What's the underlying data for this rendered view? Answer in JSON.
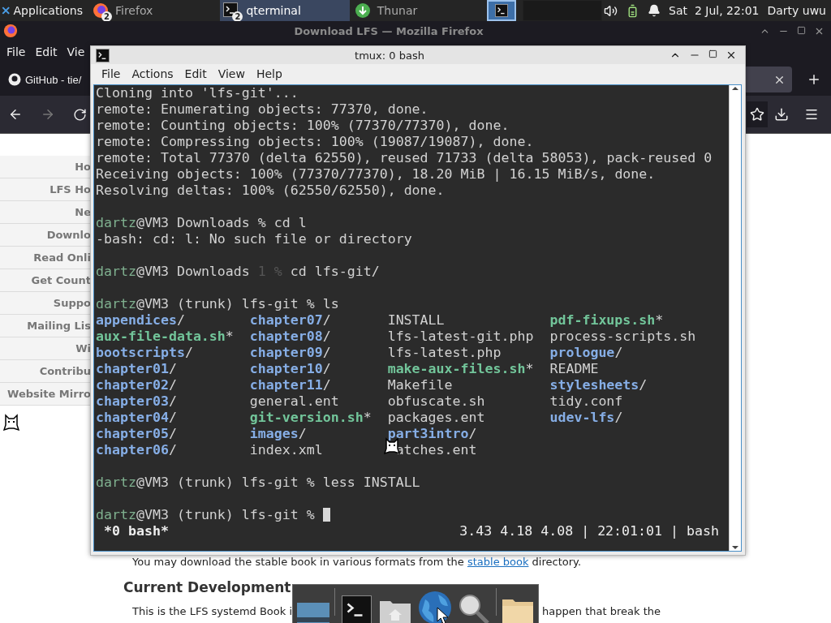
{
  "panel": {
    "apps_label": "Applications",
    "tasks": [
      {
        "kind": "firefox",
        "label": "Firefox",
        "badge": "2",
        "selected": false
      },
      {
        "kind": "terminal",
        "label": "qterminal",
        "badge": "2",
        "selected": true
      },
      {
        "kind": "files",
        "label": "Thunar",
        "selected": false
      }
    ],
    "workspaces": [
      {
        "selected": true
      },
      {
        "selected": false
      }
    ],
    "clock": "Sat  2 Jul, 22:01",
    "user": "Darty uwu"
  },
  "firefox": {
    "title": "Download LFS — Mozilla Firefox",
    "menu": [
      "File",
      "Edit",
      "Vie"
    ],
    "tabs": [
      {
        "label": "GitHub - tie/",
        "selected": false
      },
      {
        "selected": true
      }
    ],
    "sidebar": [
      "Ho",
      "LFS Ho",
      "Ne",
      "Downlo",
      "Read Onli",
      "Get Count",
      "Suppo",
      "Mailing Lis",
      "Wi",
      "Contribu",
      "Website Mirro"
    ],
    "page": {
      "intro": "You may download the stable book in various formats from the ",
      "link": "stable book",
      "intro_end": " directory.",
      "heading": "Current Development",
      "para_left": "This is the LFS systemd Book i",
      "para_right": "happen that break the"
    }
  },
  "terminal": {
    "title": "tmux: 0 bash",
    "menu": [
      "File",
      "Actions",
      "Edit",
      "View",
      "Help"
    ],
    "lines": [
      {
        "kind": "output",
        "text": "Cloning into 'lfs-git'..."
      },
      {
        "kind": "output",
        "text": "remote: Enumerating objects: 77370, done."
      },
      {
        "kind": "output",
        "text": "remote: Counting objects: 100% (77370/77370), done."
      },
      {
        "kind": "output",
        "text": "remote: Compressing objects: 100% (19087/19087), done."
      },
      {
        "kind": "output",
        "text": "remote: Total 77370 (delta 62550), reused 71733 (delta 58053), pack-reused 0"
      },
      {
        "kind": "output",
        "text": "Receiving objects: 100% (77370/77370), 18.20 MiB | 16.15 MiB/s, done."
      },
      {
        "kind": "output",
        "text": "Resolving deltas: 100% (62550/62550), done."
      },
      {
        "kind": "blank"
      },
      {
        "kind": "prompt",
        "parts": [
          {
            "text": "dartz",
            "kind": "user"
          },
          {
            "text": "@VM3 Downloads % cd l",
            "kind": "plain"
          }
        ]
      },
      {
        "kind": "output",
        "text": "-bash: cd: l: No such file or directory"
      },
      {
        "kind": "blank"
      },
      {
        "kind": "prompt",
        "parts": [
          {
            "text": "dartz",
            "kind": "user"
          },
          {
            "text": "@VM3 Downloads ",
            "kind": "plain"
          },
          {
            "text": "1 %",
            "kind": "dim"
          },
          {
            "text": " cd lfs-git/",
            "kind": "plain"
          }
        ]
      },
      {
        "kind": "blank"
      },
      {
        "kind": "prompt",
        "parts": [
          {
            "text": "dartz",
            "kind": "user"
          },
          {
            "text": "@VM3 (trunk) lfs-git % ls",
            "kind": "plain"
          }
        ]
      },
      {
        "kind": "listing",
        "rows": [
          [
            {
              "name": "appendices",
              "suffix": "/",
              "kind": "dir"
            },
            {
              "name": "chapter07",
              "suffix": "/",
              "kind": "dir"
            },
            {
              "name": "INSTALL",
              "kind": "file"
            },
            {
              "name": "pdf-fixups.sh",
              "suffix": "*",
              "kind": "exec"
            }
          ],
          [
            {
              "name": "aux-file-data.sh",
              "suffix": "*",
              "kind": "exec"
            },
            {
              "name": "chapter08",
              "suffix": "/",
              "kind": "dir"
            },
            {
              "name": "lfs-latest-git.php",
              "kind": "file"
            },
            {
              "name": "process-scripts.sh",
              "kind": "file"
            }
          ],
          [
            {
              "name": "bootscripts",
              "suffix": "/",
              "kind": "dir"
            },
            {
              "name": "chapter09",
              "suffix": "/",
              "kind": "dir"
            },
            {
              "name": "lfs-latest.php",
              "kind": "file"
            },
            {
              "name": "prologue",
              "suffix": "/",
              "kind": "dir"
            }
          ],
          [
            {
              "name": "chapter01",
              "suffix": "/",
              "kind": "dir"
            },
            {
              "name": "chapter10",
              "suffix": "/",
              "kind": "dir"
            },
            {
              "name": "make-aux-files.sh",
              "suffix": "*",
              "kind": "exec"
            },
            {
              "name": "README",
              "kind": "file"
            }
          ],
          [
            {
              "name": "chapter02",
              "suffix": "/",
              "kind": "dir"
            },
            {
              "name": "chapter11",
              "suffix": "/",
              "kind": "dir"
            },
            {
              "name": "Makefile",
              "kind": "file"
            },
            {
              "name": "stylesheets",
              "suffix": "/",
              "kind": "dir"
            }
          ],
          [
            {
              "name": "chapter03",
              "suffix": "/",
              "kind": "dir"
            },
            {
              "name": "general.ent",
              "kind": "file"
            },
            {
              "name": "obfuscate.sh",
              "kind": "file"
            },
            {
              "name": "tidy.conf",
              "kind": "file"
            }
          ],
          [
            {
              "name": "chapter04",
              "suffix": "/",
              "kind": "dir"
            },
            {
              "name": "git-version.sh",
              "suffix": "*",
              "kind": "exec"
            },
            {
              "name": "packages.ent",
              "kind": "file"
            },
            {
              "name": "udev-lfs",
              "suffix": "/",
              "kind": "dir"
            }
          ],
          [
            {
              "name": "chapter05",
              "suffix": "/",
              "kind": "dir"
            },
            {
              "name": "images",
              "suffix": "/",
              "kind": "dir"
            },
            {
              "name": "part3intro",
              "suffix": "/",
              "kind": "dir"
            }
          ],
          [
            {
              "name": "chapter06",
              "suffix": "/",
              "kind": "dir"
            },
            {
              "name": "index.xml",
              "kind": "file"
            },
            {
              "name": "atches.ent",
              "kind": "file",
              "sprite": true
            }
          ]
        ]
      },
      {
        "kind": "blank"
      },
      {
        "kind": "prompt",
        "parts": [
          {
            "text": "dartz",
            "kind": "user"
          },
          {
            "text": "@VM3 (trunk) lfs-git % less INSTALL",
            "kind": "plain"
          }
        ]
      },
      {
        "kind": "blank"
      },
      {
        "kind": "prompt",
        "cursor": true,
        "parts": [
          {
            "text": "dartz",
            "kind": "user"
          },
          {
            "text": "@VM3 (trunk) lfs-git % ",
            "kind": "plain"
          }
        ]
      }
    ],
    "status": {
      "left": "*0 bash*",
      "right": "3.43 4.18 4.08 | 22:01:01 | bash"
    }
  },
  "dock": [
    {
      "kind": "desktop"
    },
    {
      "kind": "terminal"
    },
    {
      "kind": "home"
    },
    {
      "kind": "browser"
    },
    {
      "kind": "search"
    },
    {
      "kind": "folder"
    }
  ]
}
